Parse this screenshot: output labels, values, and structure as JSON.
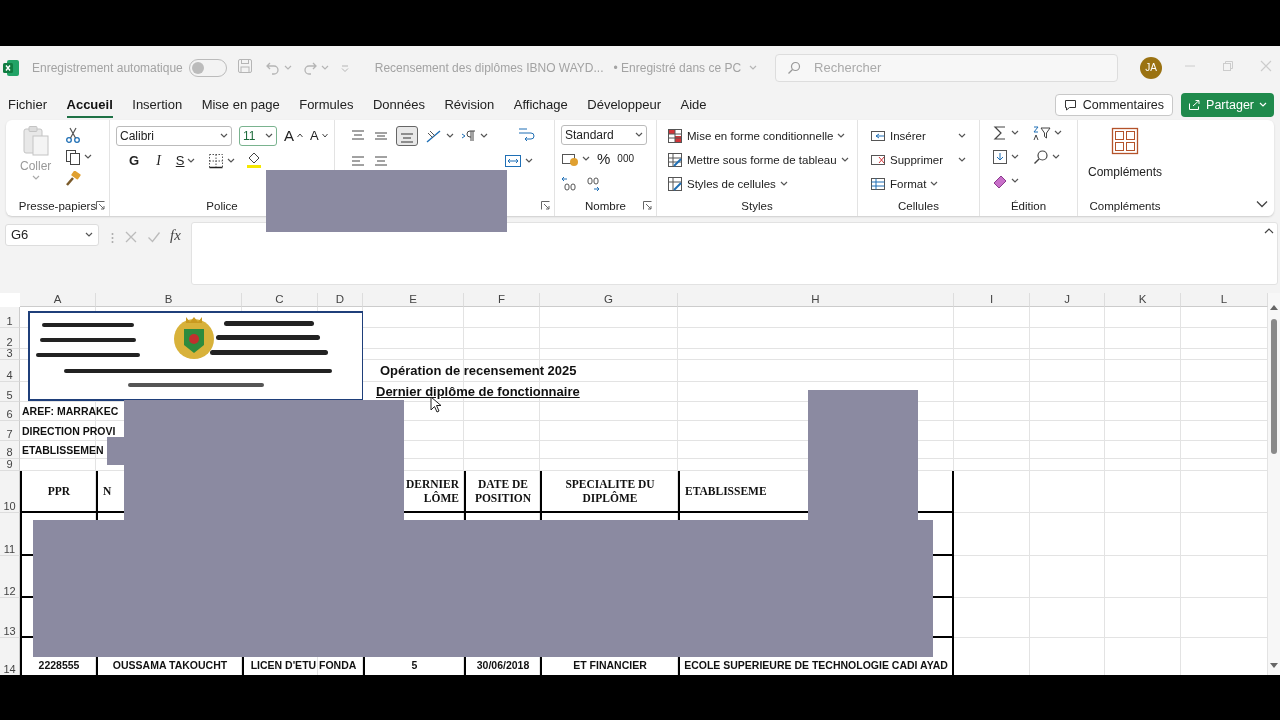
{
  "titlebar": {
    "autosave_label": "Enregistrement automatique",
    "autosave_on": false,
    "document_title": "Recensement des diplômes IBNO WAYD...",
    "save_status": "• Enregistré dans ce PC",
    "search": {
      "placeholder": "Rechercher"
    },
    "avatar": "JA"
  },
  "menu_tabs": [
    {
      "label": "Fichier",
      "selected": false
    },
    {
      "label": "Accueil",
      "selected": true
    },
    {
      "label": "Insertion",
      "selected": false
    },
    {
      "label": "Mise en page",
      "selected": false
    },
    {
      "label": "Formules",
      "selected": false
    },
    {
      "label": "Données",
      "selected": false
    },
    {
      "label": "Révision",
      "selected": false
    },
    {
      "label": "Affichage",
      "selected": false
    },
    {
      "label": "Développeur",
      "selected": false
    },
    {
      "label": "Aide",
      "selected": false
    }
  ],
  "comments_button": "Commentaires",
  "share_button": "Partager",
  "ribbon": {
    "clipboard": {
      "paste": "Coller",
      "label": "Presse-papiers"
    },
    "font": {
      "name": "Calibri",
      "size": "11",
      "grow": "A",
      "shrink": "A",
      "bold": "G",
      "italic": "I",
      "underline": "S",
      "label": "Police"
    },
    "number": {
      "format": "Standard",
      "percent": "%",
      "thousands": "000",
      "label": "Nombre"
    },
    "styles": {
      "items": [
        "Mise en forme conditionnelle",
        "Mettre sous forme de tableau",
        "Styles de cellules"
      ],
      "label": "Styles"
    },
    "cells": {
      "items": [
        "Insérer",
        "Supprimer",
        "Format"
      ],
      "label": "Cellules"
    },
    "editing": {
      "label": "Édition"
    },
    "addins": {
      "button": "Compléments",
      "label": "Compléments"
    }
  },
  "formula_bar": {
    "name_box": "G6",
    "fx": "fx"
  },
  "sheet": {
    "columns": [
      "A",
      "B",
      "C",
      "D",
      "E",
      "F",
      "G",
      "H",
      "I",
      "J",
      "K",
      "L"
    ],
    "rows": [
      "1",
      "2",
      "3",
      "4",
      "5",
      "6",
      "7",
      "8",
      "9",
      "10",
      "11",
      "12",
      "13",
      "14"
    ],
    "title": "Opération de recensement 2025",
    "subtitle": "Dernier diplôme de fonctionnaire",
    "labels": [
      "AREF: MARRAKEC",
      "DIRECTION PROVI",
      "ETABLISSEMEN"
    ],
    "table": {
      "header": {
        "A": {
          "text": "PPR"
        },
        "B": {
          "text": "N",
          "covered_right": true
        },
        "E": {
          "text": "DERNIER\nLÔME",
          "covered_left": true
        },
        "F": {
          "text": "DATE DE\nPOSITION"
        },
        "G": {
          "text": "SPECIALITE DU\nDIPLÔME"
        },
        "H": {
          "text": "ETABLISSEME",
          "covered_right": true
        }
      },
      "last_row": {
        "A": "2228555",
        "B": "OUSSAMA TAKOUCHT",
        "C": "LICEN D'ETU FONDA",
        "E": "5",
        "F": "30/06/2018",
        "G": "ET FINANCIER",
        "H": "ECOLE SUPERIEURE DE TECHNOLOGIE CADI AYAD"
      }
    }
  }
}
